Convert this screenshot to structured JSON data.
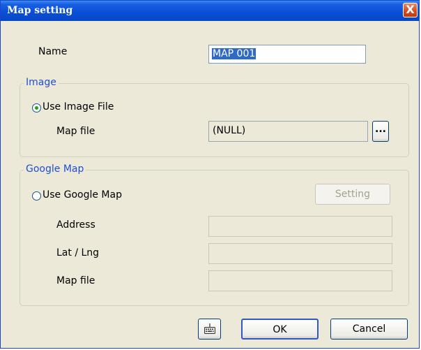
{
  "window": {
    "title": "Map setting",
    "close_glyph": "X"
  },
  "name_row": {
    "label": "Name",
    "value": "MAP 001"
  },
  "image_group": {
    "legend": "Image",
    "radio_label": "Use Image File",
    "radio_checked": true,
    "map_file_label": "Map file",
    "map_file_value": "(NULL)",
    "browse_label": "..."
  },
  "google_group": {
    "legend": "Google Map",
    "radio_label": "Use Google Map",
    "radio_checked": false,
    "setting_label": "Setting",
    "address_label": "Address",
    "address_value": "",
    "latlng_label": "Lat / Lng",
    "latlng_value": "",
    "map_file_label": "Map file",
    "map_file_value": ""
  },
  "footer": {
    "keyboard_icon": "keyboard-icon",
    "ok_label": "OK",
    "cancel_label": "Cancel"
  }
}
